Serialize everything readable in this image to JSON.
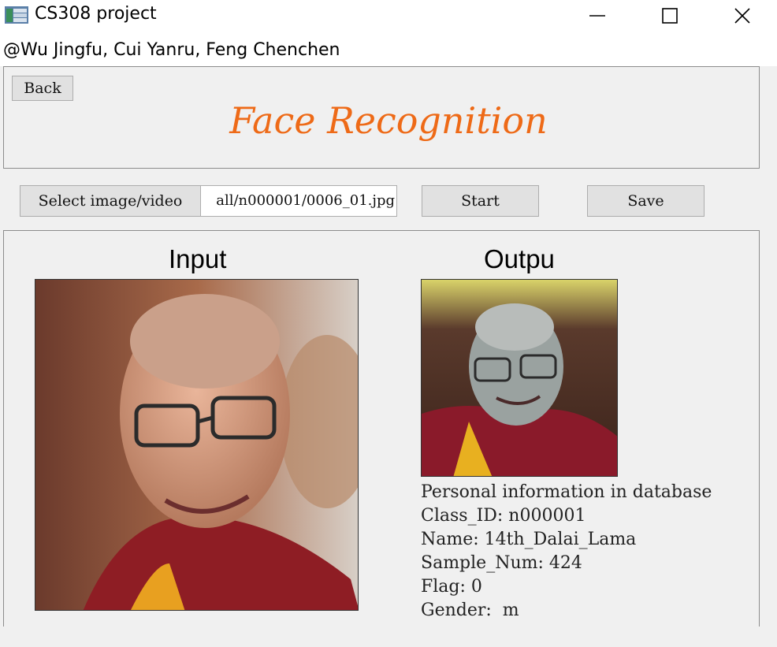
{
  "window": {
    "title": "CS308 project",
    "controls": {
      "minimize": "minimize",
      "maximize": "maximize",
      "close": "close"
    }
  },
  "header": {
    "authors": "@Wu Jingfu, Cui Yanru, Feng Chenchen"
  },
  "top_panel": {
    "back_label": "Back",
    "headline": "Face Recognition",
    "headline_color": "#ee6a17"
  },
  "toolbar": {
    "select_label": "Select image/video",
    "path_value": "all/n000001/0006_01.jpg",
    "start_label": "Start",
    "save_label": "Save"
  },
  "main": {
    "input_label": "Input",
    "output_label": "Outpu",
    "info_lines": [
      "Personal information in database",
      "Class_ID: n000001",
      "Name: 14th_Dalai_Lama",
      "Sample_Num: 424",
      "Flag: 0",
      "Gender:  m"
    ]
  }
}
